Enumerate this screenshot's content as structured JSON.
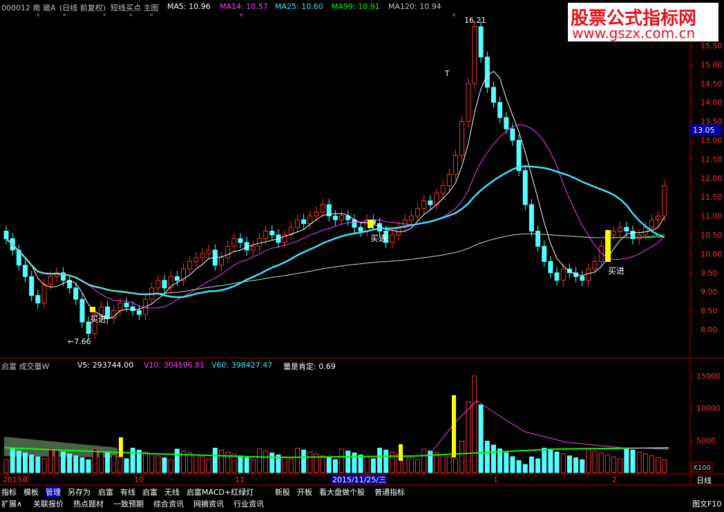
{
  "header": {
    "code_name": "000012 南  玻A",
    "mode": "(日线 前复权)",
    "indicator": "短线买点 主图",
    "ma5_label": "MA5: 10.96",
    "ma14_label": "MA14: 10.57",
    "ma25_label": "MA25: 10.60",
    "ma99_label": "MA99: 10.91",
    "ma120_label": "MA120: 10.94"
  },
  "watermark": {
    "line1": "股票公式指标网",
    "line2": "www.gszx.com.cn"
  },
  "price_axis": {
    "ticks": [
      "15.50",
      "15.00",
      "14.50",
      "14.00",
      "13.50",
      "13.00",
      "12.50",
      "12.00",
      "11.50",
      "11.00",
      "10.50",
      "10.00",
      "9.50",
      "9.00",
      "8.50",
      "8.00"
    ],
    "current_label": "13.05"
  },
  "annotations": {
    "high_label": "16.21",
    "low_label": "←7.66",
    "t_marker": "T",
    "buy1": "买进",
    "buy2": "买进",
    "buy3": "买进"
  },
  "volume_panel": {
    "title": "启富 成交量W",
    "v5": "V5: 293744.00",
    "v10": "V10: 304596.81",
    "v60": "V60: 398427.47",
    "ratio": "量是肯定: 0.69",
    "axis_ticks": [
      "15000",
      "10000",
      "5000"
    ],
    "unit": "X100"
  },
  "date_axis": {
    "labels": [
      "2015年",
      "10",
      "11",
      "2015/11/25/三",
      "1",
      "2"
    ],
    "period": "日线"
  },
  "tabs_row1": [
    "指标",
    "模板",
    "管理",
    "另存为",
    "启富",
    "有线",
    "启富",
    "无线",
    "启富MACD+红绿灯",
    "新股",
    "开板",
    "看大盘做个股",
    "普通指标"
  ],
  "tabs_row2": [
    "扩展∧",
    "关联报价",
    "热点题材",
    "一致预期",
    "综合资讯",
    "网摘资讯",
    "行业资讯"
  ],
  "bottom_right": "图文F10",
  "colors": {
    "up": "#ff3232",
    "down": "#54ffff",
    "ma5": "#ffffff",
    "ma14": "#ff40ff",
    "ma25": "#40e0ff",
    "ma99": "#00ff00",
    "ma120": "#c0c0c0",
    "signal": "#ffff00",
    "axis": "#c00000"
  }
}
